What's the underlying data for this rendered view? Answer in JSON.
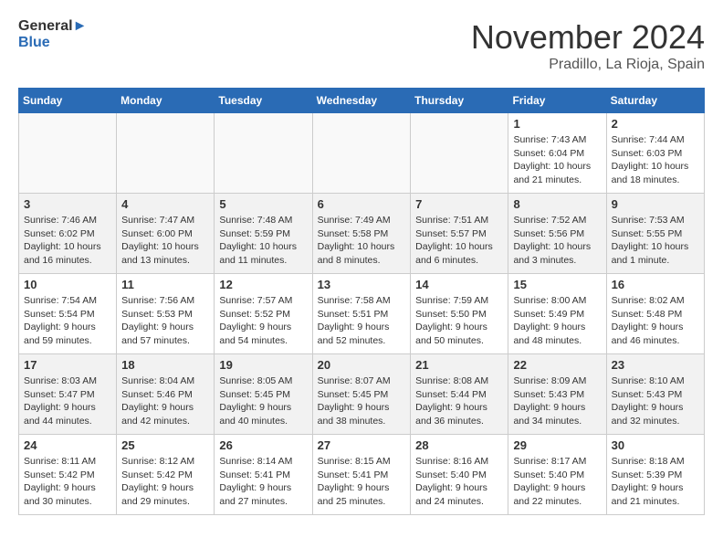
{
  "header": {
    "logo_line1": "General",
    "logo_line2": "Blue",
    "month": "November 2024",
    "location": "Pradillo, La Rioja, Spain"
  },
  "weekdays": [
    "Sunday",
    "Monday",
    "Tuesday",
    "Wednesday",
    "Thursday",
    "Friday",
    "Saturday"
  ],
  "weeks": [
    [
      {
        "day": "",
        "info": ""
      },
      {
        "day": "",
        "info": ""
      },
      {
        "day": "",
        "info": ""
      },
      {
        "day": "",
        "info": ""
      },
      {
        "day": "",
        "info": ""
      },
      {
        "day": "1",
        "info": "Sunrise: 7:43 AM\nSunset: 6:04 PM\nDaylight: 10 hours\nand 21 minutes."
      },
      {
        "day": "2",
        "info": "Sunrise: 7:44 AM\nSunset: 6:03 PM\nDaylight: 10 hours\nand 18 minutes."
      }
    ],
    [
      {
        "day": "3",
        "info": "Sunrise: 7:46 AM\nSunset: 6:02 PM\nDaylight: 10 hours\nand 16 minutes."
      },
      {
        "day": "4",
        "info": "Sunrise: 7:47 AM\nSunset: 6:00 PM\nDaylight: 10 hours\nand 13 minutes."
      },
      {
        "day": "5",
        "info": "Sunrise: 7:48 AM\nSunset: 5:59 PM\nDaylight: 10 hours\nand 11 minutes."
      },
      {
        "day": "6",
        "info": "Sunrise: 7:49 AM\nSunset: 5:58 PM\nDaylight: 10 hours\nand 8 minutes."
      },
      {
        "day": "7",
        "info": "Sunrise: 7:51 AM\nSunset: 5:57 PM\nDaylight: 10 hours\nand 6 minutes."
      },
      {
        "day": "8",
        "info": "Sunrise: 7:52 AM\nSunset: 5:56 PM\nDaylight: 10 hours\nand 3 minutes."
      },
      {
        "day": "9",
        "info": "Sunrise: 7:53 AM\nSunset: 5:55 PM\nDaylight: 10 hours\nand 1 minute."
      }
    ],
    [
      {
        "day": "10",
        "info": "Sunrise: 7:54 AM\nSunset: 5:54 PM\nDaylight: 9 hours\nand 59 minutes."
      },
      {
        "day": "11",
        "info": "Sunrise: 7:56 AM\nSunset: 5:53 PM\nDaylight: 9 hours\nand 57 minutes."
      },
      {
        "day": "12",
        "info": "Sunrise: 7:57 AM\nSunset: 5:52 PM\nDaylight: 9 hours\nand 54 minutes."
      },
      {
        "day": "13",
        "info": "Sunrise: 7:58 AM\nSunset: 5:51 PM\nDaylight: 9 hours\nand 52 minutes."
      },
      {
        "day": "14",
        "info": "Sunrise: 7:59 AM\nSunset: 5:50 PM\nDaylight: 9 hours\nand 50 minutes."
      },
      {
        "day": "15",
        "info": "Sunrise: 8:00 AM\nSunset: 5:49 PM\nDaylight: 9 hours\nand 48 minutes."
      },
      {
        "day": "16",
        "info": "Sunrise: 8:02 AM\nSunset: 5:48 PM\nDaylight: 9 hours\nand 46 minutes."
      }
    ],
    [
      {
        "day": "17",
        "info": "Sunrise: 8:03 AM\nSunset: 5:47 PM\nDaylight: 9 hours\nand 44 minutes."
      },
      {
        "day": "18",
        "info": "Sunrise: 8:04 AM\nSunset: 5:46 PM\nDaylight: 9 hours\nand 42 minutes."
      },
      {
        "day": "19",
        "info": "Sunrise: 8:05 AM\nSunset: 5:45 PM\nDaylight: 9 hours\nand 40 minutes."
      },
      {
        "day": "20",
        "info": "Sunrise: 8:07 AM\nSunset: 5:45 PM\nDaylight: 9 hours\nand 38 minutes."
      },
      {
        "day": "21",
        "info": "Sunrise: 8:08 AM\nSunset: 5:44 PM\nDaylight: 9 hours\nand 36 minutes."
      },
      {
        "day": "22",
        "info": "Sunrise: 8:09 AM\nSunset: 5:43 PM\nDaylight: 9 hours\nand 34 minutes."
      },
      {
        "day": "23",
        "info": "Sunrise: 8:10 AM\nSunset: 5:43 PM\nDaylight: 9 hours\nand 32 minutes."
      }
    ],
    [
      {
        "day": "24",
        "info": "Sunrise: 8:11 AM\nSunset: 5:42 PM\nDaylight: 9 hours\nand 30 minutes."
      },
      {
        "day": "25",
        "info": "Sunrise: 8:12 AM\nSunset: 5:42 PM\nDaylight: 9 hours\nand 29 minutes."
      },
      {
        "day": "26",
        "info": "Sunrise: 8:14 AM\nSunset: 5:41 PM\nDaylight: 9 hours\nand 27 minutes."
      },
      {
        "day": "27",
        "info": "Sunrise: 8:15 AM\nSunset: 5:41 PM\nDaylight: 9 hours\nand 25 minutes."
      },
      {
        "day": "28",
        "info": "Sunrise: 8:16 AM\nSunset: 5:40 PM\nDaylight: 9 hours\nand 24 minutes."
      },
      {
        "day": "29",
        "info": "Sunrise: 8:17 AM\nSunset: 5:40 PM\nDaylight: 9 hours\nand 22 minutes."
      },
      {
        "day": "30",
        "info": "Sunrise: 8:18 AM\nSunset: 5:39 PM\nDaylight: 9 hours\nand 21 minutes."
      }
    ]
  ]
}
